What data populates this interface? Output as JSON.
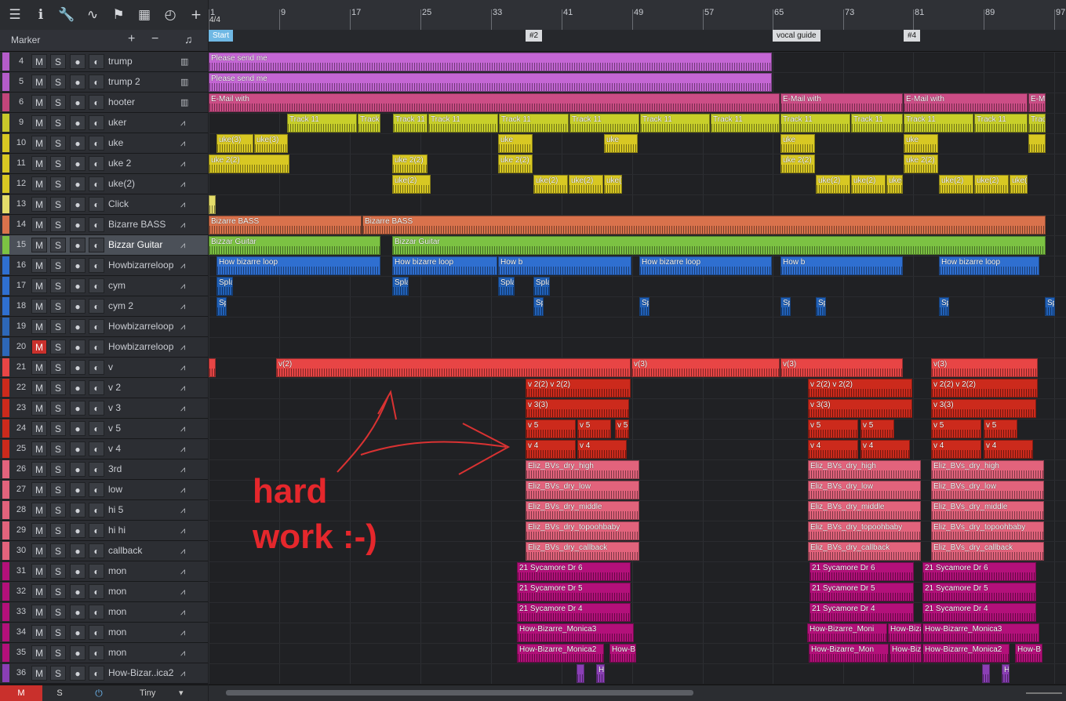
{
  "toolbar": {
    "icons": [
      "menu-icon",
      "info-icon",
      "wrench-icon",
      "automation-icon",
      "marker-flag-icon",
      "grid-icon",
      "tempo-icon",
      "add-icon"
    ]
  },
  "marker_row": {
    "label": "Marker",
    "plus": "+",
    "minus": "−",
    "note": "♫"
  },
  "ruler": {
    "signature": "4/4",
    "bars": [
      "1",
      "9",
      "17",
      "25",
      "33",
      "41",
      "49",
      "57",
      "65",
      "73",
      "81",
      "89",
      "97"
    ]
  },
  "markers": [
    "Start",
    "#2",
    "vocal guide",
    "#4"
  ],
  "tracks": [
    {
      "num": "4",
      "name": "trump",
      "color": "#b45cc9",
      "icon": "keyboard"
    },
    {
      "num": "5",
      "name": "trump 2",
      "color": "#b45cc9",
      "icon": "keyboard"
    },
    {
      "num": "6",
      "name": "hooter",
      "color": "#c2457a",
      "icon": "keyboard"
    },
    {
      "num": "9",
      "name": "uker",
      "color": "#c8c82a",
      "icon": "wave"
    },
    {
      "num": "10",
      "name": "uke",
      "color": "#d8c823",
      "icon": "wave"
    },
    {
      "num": "11",
      "name": "uke 2",
      "color": "#d8c823",
      "icon": "wave"
    },
    {
      "num": "12",
      "name": "uke(2)",
      "color": "#d8c823",
      "icon": "wave"
    },
    {
      "num": "13",
      "name": "Click",
      "color": "#e3dc6a",
      "icon": "wave"
    },
    {
      "num": "14",
      "name": "Bizarre BASS",
      "color": "#d9724c",
      "icon": "wave"
    },
    {
      "num": "15",
      "name": "Bizzar Guitar",
      "color": "#7cc243",
      "icon": "wave",
      "selected": true
    },
    {
      "num": "16",
      "name": "Howbizarreloop",
      "color": "#2f6fd0",
      "icon": "wave"
    },
    {
      "num": "17",
      "name": "cym",
      "color": "#2f6fd0",
      "icon": "wave"
    },
    {
      "num": "18",
      "name": "cym 2",
      "color": "#2f6fd0",
      "icon": "wave"
    },
    {
      "num": "19",
      "name": "Howbizarreloop",
      "color": "#2d67b8",
      "icon": "wave"
    },
    {
      "num": "20",
      "name": "Howbizarreloop",
      "color": "#2d67b8",
      "icon": "wave",
      "muted": true
    },
    {
      "num": "21",
      "name": "v",
      "color": "#e84545",
      "icon": "wave"
    },
    {
      "num": "22",
      "name": "v 2",
      "color": "#cc2a1c",
      "icon": "wave"
    },
    {
      "num": "23",
      "name": "v 3",
      "color": "#cc2a1c",
      "icon": "wave"
    },
    {
      "num": "24",
      "name": "v 5",
      "color": "#cc2a1c",
      "icon": "wave"
    },
    {
      "num": "25",
      "name": "v 4",
      "color": "#cc2a1c",
      "icon": "wave"
    },
    {
      "num": "26",
      "name": "3rd",
      "color": "#e2637c",
      "icon": "wave"
    },
    {
      "num": "27",
      "name": "low",
      "color": "#e2637c",
      "icon": "wave"
    },
    {
      "num": "28",
      "name": "hi 5",
      "color": "#e2637c",
      "icon": "wave"
    },
    {
      "num": "29",
      "name": "hi hi",
      "color": "#e2637c",
      "icon": "wave"
    },
    {
      "num": "30",
      "name": "callback",
      "color": "#e2637c",
      "icon": "wave"
    },
    {
      "num": "31",
      "name": "mon",
      "color": "#b3107a",
      "icon": "wave"
    },
    {
      "num": "32",
      "name": "mon",
      "color": "#b3107a",
      "icon": "wave"
    },
    {
      "num": "33",
      "name": "mon",
      "color": "#b3107a",
      "icon": "wave"
    },
    {
      "num": "34",
      "name": "mon",
      "color": "#b3107a",
      "icon": "wave"
    },
    {
      "num": "35",
      "name": "mon",
      "color": "#b3107a",
      "icon": "wave"
    },
    {
      "num": "36",
      "name": "How-Bizar..ica2",
      "color": "#8a3fb5",
      "icon": "wave"
    }
  ],
  "button_labels": {
    "mute": "M",
    "solo": "S",
    "record": "●",
    "monitor": "◐"
  },
  "clips": [
    {
      "t": 0,
      "s": 0,
      "e": 719,
      "c": "#c466d4",
      "l": "Please send me"
    },
    {
      "t": 1,
      "s": 0,
      "e": 719,
      "c": "#c466d4",
      "l": "Please send me"
    },
    {
      "t": 2,
      "s": 0,
      "e": 729,
      "c": "#cc4d86",
      "l": "E-Mail with"
    },
    {
      "t": 2,
      "s": 729,
      "e": 886,
      "c": "#cc4d86",
      "l": "E-Mail with"
    },
    {
      "t": 2,
      "s": 886,
      "e": 1045,
      "c": "#cc4d86",
      "l": "E-Mail with"
    },
    {
      "t": 2,
      "s": 1045,
      "e": 1068,
      "c": "#cc4d86",
      "l": "E-M"
    },
    {
      "t": 3,
      "s": 100,
      "e": 190,
      "c": "#c8cf2a",
      "l": "Track 11"
    },
    {
      "t": 3,
      "s": 190,
      "e": 220,
      "c": "#c8cf2a",
      "l": "Track"
    },
    {
      "t": 3,
      "s": 235,
      "e": 280,
      "c": "#c8cf2a",
      "l": "Track 11"
    },
    {
      "t": 3,
      "s": 280,
      "e": 370,
      "c": "#c8cf2a",
      "l": "Track 11"
    },
    {
      "t": 3,
      "s": 370,
      "e": 460,
      "c": "#c8cf2a",
      "l": "Track 11"
    },
    {
      "t": 3,
      "s": 460,
      "e": 550,
      "c": "#c8cf2a",
      "l": "Track 11"
    },
    {
      "t": 3,
      "s": 550,
      "e": 640,
      "c": "#c8cf2a",
      "l": "Track 11"
    },
    {
      "t": 3,
      "s": 640,
      "e": 729,
      "c": "#c8cf2a",
      "l": "Track 11"
    },
    {
      "t": 3,
      "s": 729,
      "e": 819,
      "c": "#c8cf2a",
      "l": "Track 11"
    },
    {
      "t": 3,
      "s": 819,
      "e": 886,
      "c": "#c8cf2a",
      "l": "Track 11"
    },
    {
      "t": 3,
      "s": 886,
      "e": 976,
      "c": "#c8cf2a",
      "l": "Track 11"
    },
    {
      "t": 3,
      "s": 976,
      "e": 1045,
      "c": "#c8cf2a",
      "l": "Track 11"
    },
    {
      "t": 3,
      "s": 1045,
      "e": 1068,
      "c": "#c8cf2a",
      "l": "Trac"
    },
    {
      "t": 4,
      "s": 10,
      "e": 58,
      "c": "#d8c823",
      "l": "uke(3)"
    },
    {
      "t": 4,
      "s": 58,
      "e": 102,
      "c": "#d8c823",
      "l": "uke(3)"
    },
    {
      "t": 4,
      "s": 369,
      "e": 414,
      "c": "#d8c823",
      "l": "uke"
    },
    {
      "t": 4,
      "s": 504,
      "e": 548,
      "c": "#d8c823",
      "l": "uke"
    },
    {
      "t": 4,
      "s": 729,
      "e": 774,
      "c": "#d8c823",
      "l": "uke"
    },
    {
      "t": 4,
      "s": 886,
      "e": 931,
      "c": "#d8c823",
      "l": "uke"
    },
    {
      "t": 4,
      "s": 1045,
      "e": 1068,
      "c": "#d8c823",
      "l": ""
    },
    {
      "t": 5,
      "s": 0,
      "e": 104,
      "c": "#d8c823",
      "l": "uke 2(2)"
    },
    {
      "t": 5,
      "s": 234,
      "e": 280,
      "c": "#d8c823",
      "l": "uke 2(2)"
    },
    {
      "t": 5,
      "s": 369,
      "e": 414,
      "c": "#d8c823",
      "l": "uke 2(2)"
    },
    {
      "t": 5,
      "s": 729,
      "e": 774,
      "c": "#d8c823",
      "l": "uke 2(2)"
    },
    {
      "t": 5,
      "s": 886,
      "e": 931,
      "c": "#d8c823",
      "l": "uke 2(2)"
    },
    {
      "t": 6,
      "s": 234,
      "e": 284,
      "c": "#d8c823",
      "l": "uke(2)"
    },
    {
      "t": 6,
      "s": 414,
      "e": 459,
      "c": "#d8c823",
      "l": "uke(2)"
    },
    {
      "t": 6,
      "s": 459,
      "e": 504,
      "c": "#d8c823",
      "l": "uke(2)"
    },
    {
      "t": 6,
      "s": 504,
      "e": 528,
      "c": "#d8c823",
      "l": "uke("
    },
    {
      "t": 6,
      "s": 774,
      "e": 819,
      "c": "#d8c823",
      "l": "uke(2)"
    },
    {
      "t": 6,
      "s": 819,
      "e": 864,
      "c": "#d8c823",
      "l": "uke(2)"
    },
    {
      "t": 6,
      "s": 864,
      "e": 886,
      "c": "#d8c823",
      "l": "uke("
    },
    {
      "t": 6,
      "s": 931,
      "e": 976,
      "c": "#d8c823",
      "l": "uke(2)"
    },
    {
      "t": 6,
      "s": 976,
      "e": 1021,
      "c": "#d8c823",
      "l": "uke(2)"
    },
    {
      "t": 6,
      "s": 1021,
      "e": 1045,
      "c": "#d8c823",
      "l": "uke("
    },
    {
      "t": 7,
      "s": 0,
      "e": 10,
      "c": "#e3dc6a",
      "l": ""
    },
    {
      "t": 8,
      "s": 0,
      "e": 196,
      "c": "#d9724c",
      "l": "Bizarre BASS"
    },
    {
      "t": 8,
      "s": 196,
      "e": 1068,
      "c": "#d9724c",
      "l": "Bizarre BASS"
    },
    {
      "t": 9,
      "s": 0,
      "e": 220,
      "c": "#7cc243",
      "l": "Bizzar Guitar"
    },
    {
      "t": 9,
      "s": 234,
      "e": 1068,
      "c": "#7cc243",
      "l": "Bizzar Guitar"
    },
    {
      "t": 10,
      "s": 10,
      "e": 220,
      "c": "#2f6fd0",
      "l": "How bizarre loop"
    },
    {
      "t": 10,
      "s": 234,
      "e": 369,
      "c": "#2f6fd0",
      "l": "How bizarre loop"
    },
    {
      "t": 10,
      "s": 369,
      "e": 540,
      "c": "#2f6fd0",
      "l": "How b"
    },
    {
      "t": 10,
      "s": 549,
      "e": 719,
      "c": "#2f6fd0",
      "l": "How bizarre loop"
    },
    {
      "t": 10,
      "s": 729,
      "e": 886,
      "c": "#2f6fd0",
      "l": "How b"
    },
    {
      "t": 10,
      "s": 931,
      "e": 1060,
      "c": "#2f6fd0",
      "l": "How bizarre loop"
    },
    {
      "t": 11,
      "s": 10,
      "e": 32,
      "c": "#2161b8",
      "l": "Spla"
    },
    {
      "t": 11,
      "s": 234,
      "e": 256,
      "c": "#2161b8",
      "l": "Spla"
    },
    {
      "t": 11,
      "s": 369,
      "e": 391,
      "c": "#2161b8",
      "l": "Spla"
    },
    {
      "t": 11,
      "s": 414,
      "e": 436,
      "c": "#2161b8",
      "l": "Spla"
    },
    {
      "t": 12,
      "s": 10,
      "e": 24,
      "c": "#2161b8",
      "l": "Sp"
    },
    {
      "t": 12,
      "s": 414,
      "e": 428,
      "c": "#2161b8",
      "l": "Sp"
    },
    {
      "t": 12,
      "s": 549,
      "e": 563,
      "c": "#2161b8",
      "l": "Sp"
    },
    {
      "t": 12,
      "s": 729,
      "e": 743,
      "c": "#2161b8",
      "l": "Sp"
    },
    {
      "t": 12,
      "s": 774,
      "e": 788,
      "c": "#2161b8",
      "l": "Sp"
    },
    {
      "t": 12,
      "s": 931,
      "e": 945,
      "c": "#2161b8",
      "l": "Sp"
    },
    {
      "t": 12,
      "s": 1066,
      "e": 1080,
      "c": "#2161b8",
      "l": "Sp"
    },
    {
      "t": 15,
      "s": 0,
      "e": 10,
      "c": "#e84545",
      "l": ""
    },
    {
      "t": 15,
      "s": 86,
      "e": 539,
      "c": "#e84545",
      "l": "v(2)"
    },
    {
      "t": 15,
      "s": 539,
      "e": 729,
      "c": "#e84545",
      "l": "v(3)"
    },
    {
      "t": 15,
      "s": 729,
      "e": 886,
      "c": "#e84545",
      "l": "v(3)"
    },
    {
      "t": 15,
      "s": 921,
      "e": 1058,
      "c": "#e84545",
      "l": "v(3)"
    },
    {
      "t": 16,
      "s": 404,
      "e": 539,
      "c": "#cc2a1c",
      "l": "v 2(2) v 2(2)"
    },
    {
      "t": 16,
      "s": 764,
      "e": 898,
      "c": "#cc2a1c",
      "l": "v 2(2) v 2(2)"
    },
    {
      "t": 16,
      "s": 921,
      "e": 1058,
      "c": "#cc2a1c",
      "l": "v 2(2) v 2(2)"
    },
    {
      "t": 17,
      "s": 404,
      "e": 537,
      "c": "#cc2a1c",
      "l": "v 3(3)"
    },
    {
      "t": 17,
      "s": 764,
      "e": 898,
      "c": "#cc2a1c",
      "l": "v 3(3)"
    },
    {
      "t": 17,
      "s": 921,
      "e": 1056,
      "c": "#cc2a1c",
      "l": "v 3(3)"
    },
    {
      "t": 18,
      "s": 404,
      "e": 469,
      "c": "#cc2a1c",
      "l": "v 5"
    },
    {
      "t": 18,
      "s": 470,
      "e": 514,
      "c": "#cc2a1c",
      "l": "v 5"
    },
    {
      "t": 18,
      "s": 518,
      "e": 537,
      "c": "#cc2a1c",
      "l": "v 5"
    },
    {
      "t": 18,
      "s": 764,
      "e": 829,
      "c": "#cc2a1c",
      "l": "v 5"
    },
    {
      "t": 18,
      "s": 831,
      "e": 875,
      "c": "#cc2a1c",
      "l": "v 5"
    },
    {
      "t": 18,
      "s": 921,
      "e": 986,
      "c": "#cc2a1c",
      "l": "v 5"
    },
    {
      "t": 18,
      "s": 988,
      "e": 1032,
      "c": "#cc2a1c",
      "l": "v 5"
    },
    {
      "t": 19,
      "s": 404,
      "e": 469,
      "c": "#cc2a1c",
      "l": "v 4"
    },
    {
      "t": 19,
      "s": 470,
      "e": 534,
      "c": "#cc2a1c",
      "l": "v 4"
    },
    {
      "t": 19,
      "s": 764,
      "e": 829,
      "c": "#cc2a1c",
      "l": "v 4"
    },
    {
      "t": 19,
      "s": 831,
      "e": 895,
      "c": "#cc2a1c",
      "l": "v 4"
    },
    {
      "t": 19,
      "s": 921,
      "e": 986,
      "c": "#cc2a1c",
      "l": "v 4"
    },
    {
      "t": 19,
      "s": 988,
      "e": 1052,
      "c": "#cc2a1c",
      "l": "v 4"
    },
    {
      "t": 20,
      "s": 404,
      "e": 550,
      "c": "#e2637c",
      "l": "Eliz_BVs_dry_high"
    },
    {
      "t": 20,
      "s": 764,
      "e": 909,
      "c": "#e2637c",
      "l": "Eliz_BVs_dry_high"
    },
    {
      "t": 20,
      "s": 921,
      "e": 1066,
      "c": "#e2637c",
      "l": "Eliz_BVs_dry_high"
    },
    {
      "t": 21,
      "s": 404,
      "e": 550,
      "c": "#e2637c",
      "l": "Eliz_BVs_dry_low"
    },
    {
      "t": 21,
      "s": 764,
      "e": 909,
      "c": "#e2637c",
      "l": "Eliz_BVs_dry_low"
    },
    {
      "t": 21,
      "s": 921,
      "e": 1066,
      "c": "#e2637c",
      "l": "Eliz_BVs_dry_low"
    },
    {
      "t": 22,
      "s": 404,
      "e": 550,
      "c": "#e2637c",
      "l": "Eliz_BVs_dry_middle"
    },
    {
      "t": 22,
      "s": 764,
      "e": 909,
      "c": "#e2637c",
      "l": "Eliz_BVs_dry_middle"
    },
    {
      "t": 22,
      "s": 921,
      "e": 1066,
      "c": "#e2637c",
      "l": "Eliz_BVs_dry_middle"
    },
    {
      "t": 23,
      "s": 404,
      "e": 550,
      "c": "#e2637c",
      "l": "Eliz_BVs_dry_topoohbaby"
    },
    {
      "t": 23,
      "s": 764,
      "e": 909,
      "c": "#e2637c",
      "l": "Eliz_BVs_dry_topoohbaby"
    },
    {
      "t": 23,
      "s": 921,
      "e": 1066,
      "c": "#e2637c",
      "l": "Eliz_BVs_dry_topoohbaby"
    },
    {
      "t": 24,
      "s": 404,
      "e": 550,
      "c": "#e2637c",
      "l": "Eliz_BVs_dry_callback"
    },
    {
      "t": 24,
      "s": 764,
      "e": 909,
      "c": "#e2637c",
      "l": "Eliz_BVs_dry_callback"
    },
    {
      "t": 24,
      "s": 921,
      "e": 1066,
      "c": "#e2637c",
      "l": "Eliz_BVs_dry_callback"
    },
    {
      "t": 25,
      "s": 393,
      "e": 539,
      "c": "#b3107a",
      "l": "21 Sycamore Dr 6"
    },
    {
      "t": 25,
      "s": 766,
      "e": 900,
      "c": "#b3107a",
      "l": "21 Sycamore Dr 6"
    },
    {
      "t": 25,
      "s": 910,
      "e": 1056,
      "c": "#b3107a",
      "l": "21 Sycamore Dr 6"
    },
    {
      "t": 26,
      "s": 393,
      "e": 539,
      "c": "#b3107a",
      "l": "21 Sycamore Dr 5"
    },
    {
      "t": 26,
      "s": 766,
      "e": 900,
      "c": "#b3107a",
      "l": "21 Sycamore Dr 5"
    },
    {
      "t": 26,
      "s": 910,
      "e": 1056,
      "c": "#b3107a",
      "l": "21 Sycamore Dr 5"
    },
    {
      "t": 27,
      "s": 393,
      "e": 539,
      "c": "#b3107a",
      "l": "21 Sycamore Dr 4"
    },
    {
      "t": 27,
      "s": 766,
      "e": 900,
      "c": "#b3107a",
      "l": "21 Sycamore Dr 4"
    },
    {
      "t": 27,
      "s": 910,
      "e": 1056,
      "c": "#b3107a",
      "l": "21 Sycamore Dr 4"
    },
    {
      "t": 28,
      "s": 393,
      "e": 543,
      "c": "#b3107a",
      "l": "How-Bizarre_Monica3"
    },
    {
      "t": 28,
      "s": 763,
      "e": 866,
      "c": "#b3107a",
      "l": "How-Bizarre_Moni"
    },
    {
      "t": 28,
      "s": 866,
      "e": 910,
      "c": "#b3107a",
      "l": "How-Bizarre_Monica3"
    },
    {
      "t": 28,
      "s": 910,
      "e": 1060,
      "c": "#b3107a",
      "l": "How-Bizarre_Monica3"
    },
    {
      "t": 29,
      "s": 393,
      "e": 505,
      "c": "#b3107a",
      "l": "How-Bizarre_Monica2"
    },
    {
      "t": 29,
      "s": 511,
      "e": 546,
      "c": "#b3107a",
      "l": "How-B"
    },
    {
      "t": 29,
      "s": 765,
      "e": 868,
      "c": "#b3107a",
      "l": "How-Bizarre_Mon"
    },
    {
      "t": 29,
      "s": 868,
      "e": 910,
      "c": "#b3107a",
      "l": "How-Bizarre_Monica2"
    },
    {
      "t": 29,
      "s": 910,
      "e": 1022,
      "c": "#b3107a",
      "l": "How-Bizarre_Monica2"
    },
    {
      "t": 29,
      "s": 1028,
      "e": 1064,
      "c": "#b3107a",
      "l": "How-B"
    },
    {
      "t": 30,
      "s": 469,
      "e": 480,
      "c": "#8a3fb5",
      "l": ""
    },
    {
      "t": 30,
      "s": 494,
      "e": 506,
      "c": "#8a3fb5",
      "l": "H"
    },
    {
      "t": 30,
      "s": 986,
      "e": 997,
      "c": "#8a3fb5",
      "l": ""
    },
    {
      "t": 30,
      "s": 1011,
      "e": 1022,
      "c": "#8a3fb5",
      "l": "H"
    }
  ],
  "annotation": {
    "line1": "hard",
    "line2": "work :-)"
  },
  "bottom_bar": {
    "mute": "M",
    "solo": "S",
    "power": "⏻",
    "size": "Tiny",
    "menu": "▾"
  }
}
